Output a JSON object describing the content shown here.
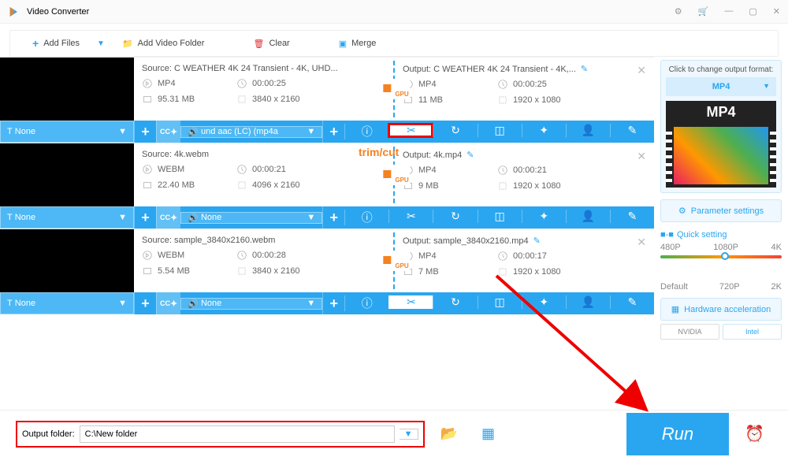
{
  "window": {
    "title": "Video Converter"
  },
  "toolbar": {
    "add_files": "Add Files",
    "add_folder": "Add Video Folder",
    "clear": "Clear",
    "merge": "Merge"
  },
  "items": [
    {
      "source_title": "Source: C  WEATHER  4K 24  Transient - 4K, UHD...",
      "output_title": "Output: C  WEATHER  4K 24  Transient - 4K,...",
      "src": {
        "format": "MP4",
        "duration": "00:00:25",
        "size": "95.31 MB",
        "dims": "3840 x 2160"
      },
      "out": {
        "format": "MP4",
        "duration": "00:00:25",
        "size": "11 MB",
        "dims": "1920 x 1080"
      },
      "subtitle": "None",
      "audio": "und aac (LC) (mp4a",
      "highlight_cut": true
    },
    {
      "source_title": "Source: 4k.webm",
      "output_title": "Output: 4k.mp4",
      "src": {
        "format": "WEBM",
        "duration": "00:00:21",
        "size": "22.40 MB",
        "dims": "4096 x 2160"
      },
      "out": {
        "format": "MP4",
        "duration": "00:00:21",
        "size": "9 MB",
        "dims": "1920 x 1080"
      },
      "subtitle": "None",
      "audio": "None"
    },
    {
      "source_title": "Source: sample_3840x2160.webm",
      "output_title": "Output: sample_3840x2160.mp4",
      "src": {
        "format": "WEBM",
        "duration": "00:00:28",
        "size": "5.54 MB",
        "dims": "3840 x 2160"
      },
      "out": {
        "format": "MP4",
        "duration": "00:00:17",
        "size": "7 MB",
        "dims": "1920 x 1080"
      },
      "subtitle": "None",
      "audio": "None",
      "highlight_cut_blue": true
    }
  ],
  "annot": {
    "trim_cut": "trim/cut"
  },
  "side": {
    "change_format": "Click to change output format:",
    "format": "MP4",
    "param": "Parameter settings",
    "quick": "Quick setting",
    "presets": [
      "480P",
      "1080P",
      "4K"
    ],
    "presets2": [
      "Default",
      "720P",
      "2K"
    ],
    "hw": "Hardware acceleration",
    "nvidia": "NVIDIA",
    "intel": "Intel"
  },
  "bottom": {
    "label": "Output folder:",
    "path": "C:\\New folder",
    "run": "Run"
  }
}
